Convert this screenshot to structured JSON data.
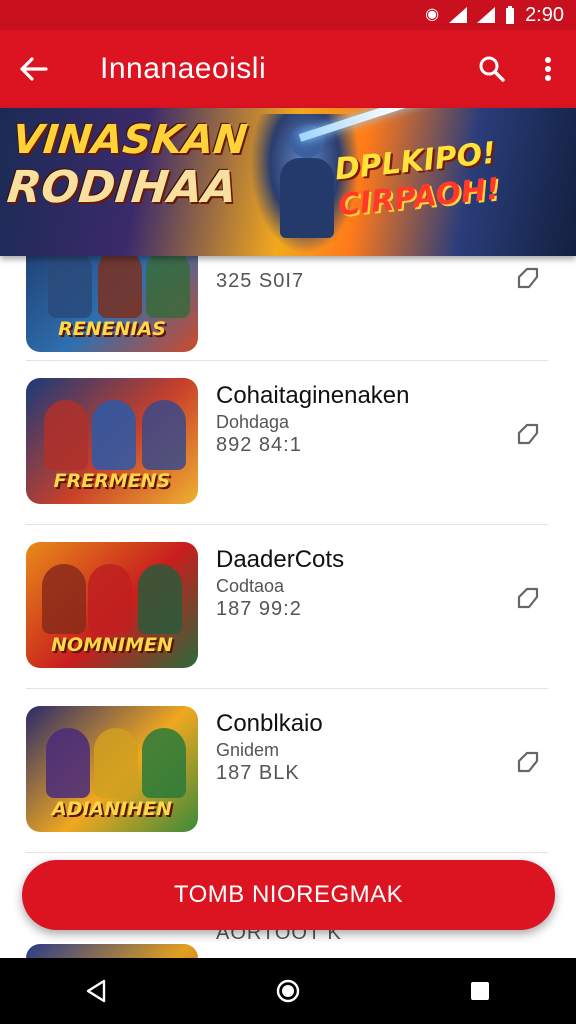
{
  "status_bar": {
    "time": "2:90",
    "icons": [
      "record-icon",
      "signal-icon",
      "signal-icon",
      "battery-icon"
    ]
  },
  "app_bar": {
    "title": "Innanaeoisli",
    "back_icon": "arrow-left-icon",
    "search_icon": "search-icon",
    "menu_icon": "more-vert-icon"
  },
  "banner": {
    "title_line1": "VINASKAN",
    "title_line2": "RODIHAA",
    "right_line1": "DPLKIPO!",
    "right_line2": "CIRPAOH!"
  },
  "items": [
    {
      "thumb_caption": "RENENIAS",
      "name": "",
      "subtitle": "",
      "meta": "325 S0I7",
      "theme": [
        "#1d3a6a",
        "#2f6fb0",
        "#d04a2a"
      ]
    },
    {
      "thumb_caption": "FRERMENS",
      "name": "Cohaitaginenaken",
      "subtitle": "Dohdaga",
      "meta": "892 84:1",
      "theme": [
        "#1a3a7a",
        "#c8402a",
        "#f0b030"
      ]
    },
    {
      "thumb_caption": "NOMNIMEN",
      "name": "DaaderCots",
      "subtitle": "Codtaoa",
      "meta": "187 99:2",
      "theme": [
        "#e88a1a",
        "#c81e1e",
        "#2a6a3a"
      ]
    },
    {
      "thumb_caption": "ADIANIHEN",
      "name": "Conblkaio",
      "subtitle": "Gnidem",
      "meta": "187 BLK",
      "theme": [
        "#2a2a6a",
        "#f0a820",
        "#3a8a3a"
      ]
    },
    {
      "thumb_caption": "",
      "name": "",
      "subtitle": "",
      "meta": "AORTOOT K",
      "theme": [
        "#2a3a8a",
        "#e0a020",
        "#c03a2a"
      ]
    }
  ],
  "cta": {
    "label": "TOMB NIOREGMAK"
  },
  "nav": {
    "back": "nav-back-icon",
    "home": "nav-home-icon",
    "recents": "nav-recents-icon"
  }
}
